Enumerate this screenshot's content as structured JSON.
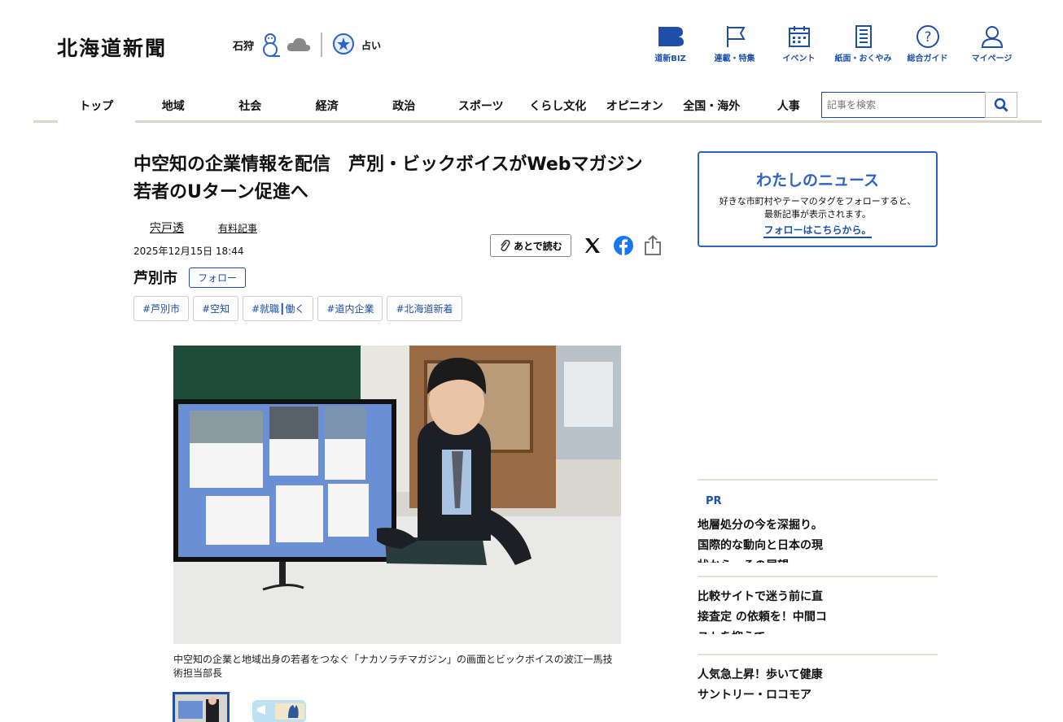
{
  "header": {
    "logo": "北海道新聞",
    "weather_city": "石狩",
    "fortune": "占い",
    "icons": [
      {
        "name": "dousin-biz-icon",
        "label": "道新BIZ"
      },
      {
        "name": "flag-icon",
        "label": "連載・特集"
      },
      {
        "name": "calendar-icon",
        "label": "イベント"
      },
      {
        "name": "newspaper-icon",
        "label": "紙面・おくやみ"
      },
      {
        "name": "question-icon",
        "label": "総合ガイド"
      },
      {
        "name": "user-icon",
        "label": "マイページ"
      }
    ]
  },
  "nav": {
    "items": [
      "トップ",
      "地域",
      "社会",
      "経済",
      "政治",
      "スポーツ",
      "くらし文化",
      "オピニオン",
      "全国・海外",
      "人事"
    ],
    "search_placeholder": "記事を検索"
  },
  "article": {
    "title": "中空知の企業情報を配信　芦別・ビックボイスがWebマガジン　若者のUターン促進へ",
    "author": "宍戸透",
    "paid": "有料記事",
    "date": "2025年12月15日 18:44",
    "read_later": "あとで読む",
    "location": "芦別市",
    "follow": "フォロー",
    "tags": [
      "#芦別市",
      "#空知",
      "#就職┃働く",
      "#道内企業",
      "#北海道新着"
    ],
    "caption": "中空知の企業と地域出身の若者をつなぐ「ナカソラチマガジン」の画面とビックボイスの波江一馬技術担当部長"
  },
  "sidebar": {
    "mynews_title": "わたしのニュース",
    "mynews_desc1": "好きな市町村やテーマのタグをフォローすると、",
    "mynews_desc2": "最新記事が表示されます。",
    "mynews_link": "フォローはこちらから。",
    "pr_label": "PR",
    "pr_items": [
      "地層処分の今を深掘り。国際的な動向と日本の現状から、その展望",
      "比較サイトで迷う前に直接査定 の依頼を！中間コストを抑えて",
      "人気急上昇！歩いて健康　サントリー・ロコモア"
    ]
  },
  "colors": {
    "accent": "#1e4fa8",
    "nav_border": "#dcd5c5"
  }
}
